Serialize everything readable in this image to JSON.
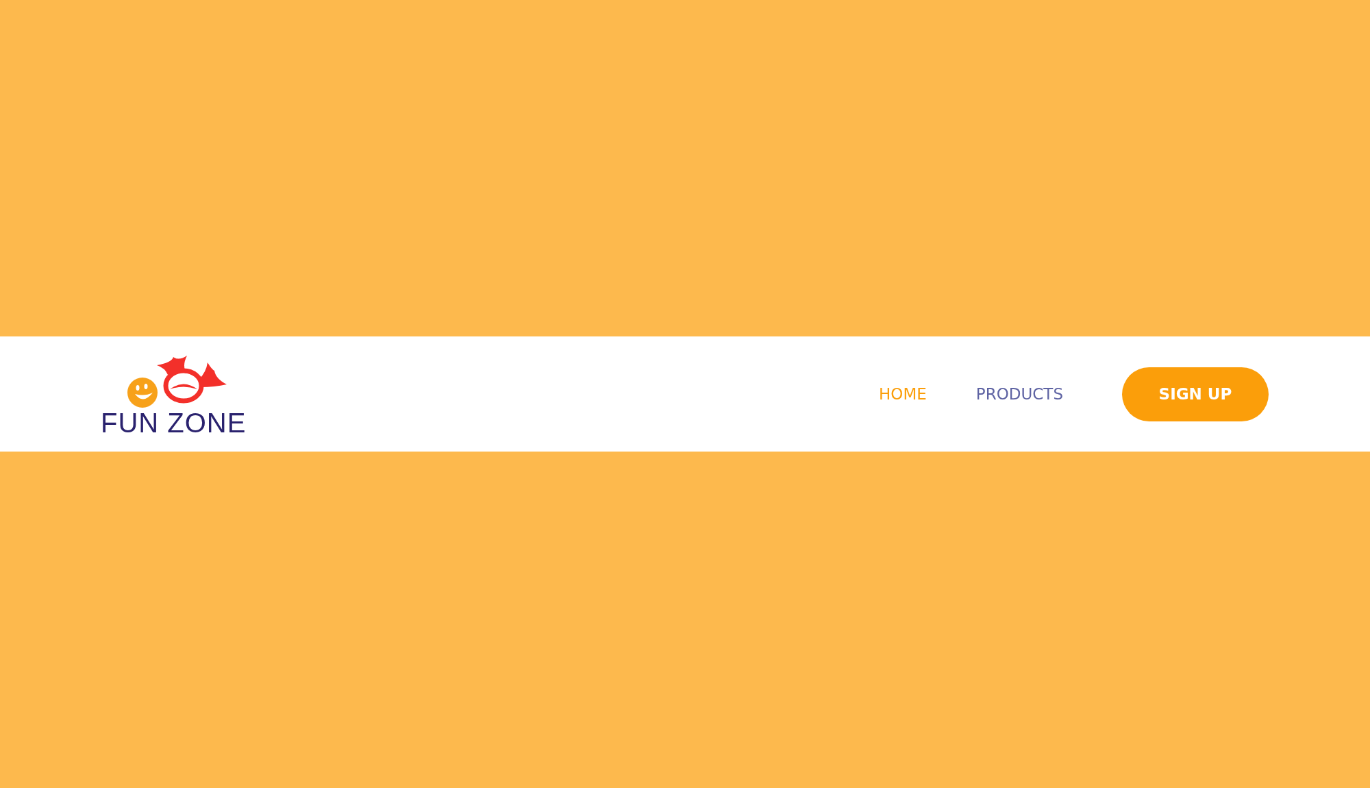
{
  "navbar": {
    "logo": {
      "text": "FUN ZONE"
    },
    "links": [
      {
        "label": "HOME",
        "selected": true
      },
      {
        "label": "PRODUCTS",
        "selected": false
      }
    ],
    "button": {
      "label": "SIGN UP"
    }
  }
}
